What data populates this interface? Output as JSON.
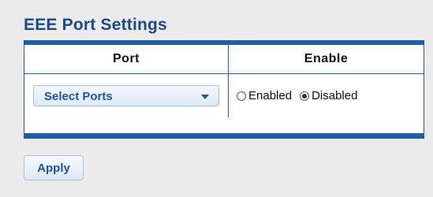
{
  "title": "EEE Port Settings",
  "table": {
    "headers": {
      "port": "Port",
      "enable": "Enable"
    },
    "row": {
      "port_select": {
        "value": "Select Ports"
      },
      "enable_options": [
        {
          "label": "Enabled",
          "checked": false
        },
        {
          "label": "Disabled",
          "checked": true
        }
      ]
    }
  },
  "apply_label": "Apply",
  "colors": {
    "accent": "#1f5fa8",
    "title": "#1a4a8a",
    "control_text": "#1d56a3",
    "background": "#ebebeb"
  }
}
